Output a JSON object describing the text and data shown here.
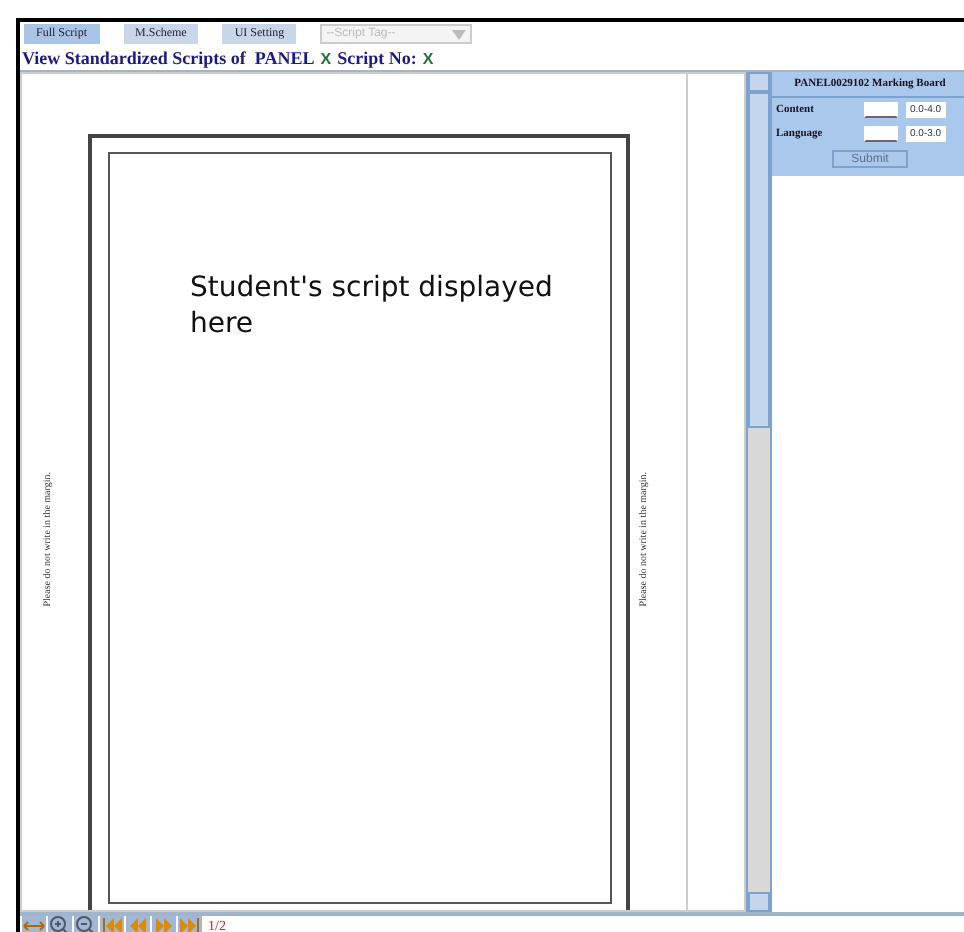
{
  "toolbar": {
    "tabs": [
      {
        "label": "Full Script",
        "selected": true
      },
      {
        "label": "M.Scheme",
        "selected": false
      },
      {
        "label": "UI Setting",
        "selected": false
      }
    ],
    "tag_select": {
      "placeholder": "--Script Tag--",
      "disabled": true
    }
  },
  "heading": {
    "text": "View Standardized Scripts of  PANEL",
    "mark_1": "X",
    "label": "Script No:",
    "mark_2": "X"
  },
  "script": {
    "message": "Student's script displayed here",
    "margin_left": "Please do not write in the margin.",
    "margin_right": "Please do not write in the margin."
  },
  "marking_board": {
    "title": "PANEL0029102 Marking Board",
    "criteria": [
      {
        "name": "Content",
        "range": "0.0-4.0"
      },
      {
        "name": "Language",
        "range": "0.0-3.0"
      }
    ],
    "submit": {
      "label": "Submit",
      "disabled": true
    }
  },
  "pager": {
    "buttons": [
      {
        "kind": "fit"
      },
      {
        "kind": "zoom-in"
      },
      {
        "kind": "zoom-out"
      },
      {
        "kind": "first"
      },
      {
        "kind": "prev"
      },
      {
        "kind": "next"
      },
      {
        "kind": "last"
      }
    ],
    "page": "1/2"
  }
}
